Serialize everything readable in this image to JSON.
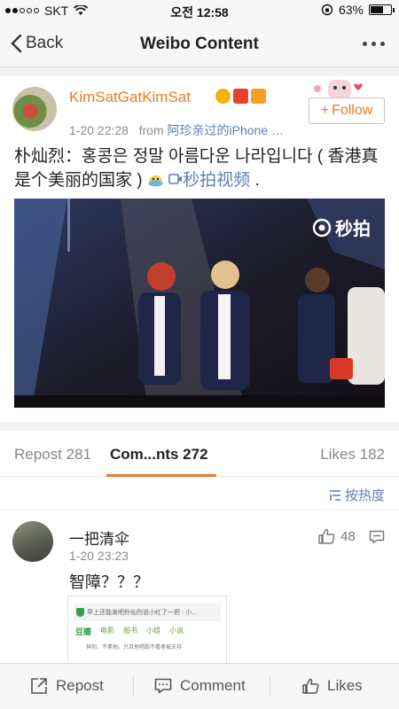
{
  "status_bar": {
    "carrier": "SKT",
    "time": "오전 12:58",
    "battery": "63%",
    "battery_level": 0.63
  },
  "nav": {
    "back_label": "Back",
    "title": "Weibo Content"
  },
  "post": {
    "username": "KimSatGatKimSat",
    "follow_label": "Follow",
    "timestamp": "1-20 22:28",
    "from_label": "from",
    "source": "阿珍亲过的iPhone …",
    "text_main": "朴灿烈：홍콩은 정말 아름다운 나라입니다 ( 香港真是个美丽的国家 ) ",
    "video_link": "秒拍视频",
    "text_end": " .",
    "watermark": "秒拍"
  },
  "tabs": {
    "repost": "Repost 281",
    "comments": "Com...nts 272",
    "likes": "Likes 182"
  },
  "sort_label": "按热度",
  "comment": {
    "name": "一把清伞",
    "time": "1-20 23:23",
    "likes": "48",
    "text": "智障？？？",
    "image_text": {
      "bar": "早上还能发吧朴灿烈说小红了一把 - 小...",
      "logo": "豆瓣",
      "tab1": "电影",
      "tab2": "图书",
      "tab3": "小组",
      "tab4": "小说",
      "line": "神到，不素他。只且他唱歌不看者被支持"
    }
  },
  "toolbar": {
    "repost": "Repost",
    "comment": "Comment",
    "likes": "Likes"
  },
  "colors": {
    "accent": "#ea7a2a",
    "link": "#5a7fb8"
  }
}
